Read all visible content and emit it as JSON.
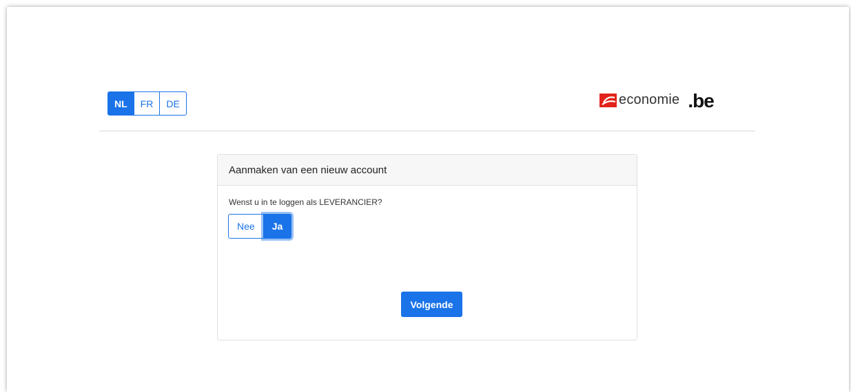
{
  "header": {
    "languages": [
      "NL",
      "FR",
      "DE"
    ],
    "active_language": "NL",
    "logo": {
      "word": "economie",
      "suffix": ".be",
      "brand_color": "#e2231a"
    }
  },
  "card": {
    "title": "Aanmaken van een nieuw account",
    "question": "Wenst u in te loggen als LEVERANCIER?",
    "options": [
      "Nee",
      "Ja"
    ],
    "selected_option": "Ja",
    "next_label": "Volgende"
  },
  "colors": {
    "accent": "#1a73e8"
  }
}
